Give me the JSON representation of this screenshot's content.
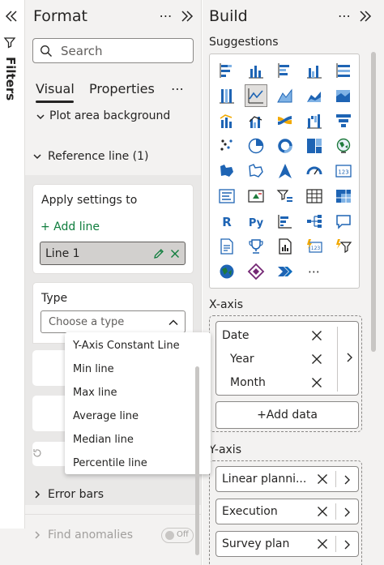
{
  "filters_rail": {
    "label": "Filters"
  },
  "format_pane": {
    "title": "Format",
    "search": {
      "placeholder": "Search",
      "value": ""
    },
    "tabs": [
      {
        "label": "Visual",
        "selected": true
      },
      {
        "label": "Properties",
        "selected": false
      }
    ],
    "plot_area_section": "Plot area background",
    "reference_line": {
      "header": "Reference line (1)",
      "apply_settings_label": "Apply settings to",
      "add_line_label": "+ Add line",
      "selected_line": "Line 1",
      "type_label": "Type",
      "type_placeholder": "Choose a type",
      "type_options": [
        "Y-Axis Constant Line",
        "Min line",
        "Max line",
        "Average line",
        "Median line",
        "Percentile line"
      ]
    },
    "error_bars": "Error bars",
    "find_anomalies": {
      "label": "Find anomalies",
      "toggle": "Off"
    }
  },
  "build_pane": {
    "title": "Build",
    "suggestions_label": "Suggestions",
    "xaxis": {
      "label": "X-axis",
      "fields": [
        "Date",
        "Year",
        "Month"
      ],
      "add_data_label": "+Add data"
    },
    "yaxis": {
      "label": "Y-axis",
      "fields": [
        "Linear planni...",
        "Execution",
        "Survey plan"
      ]
    }
  },
  "colors": {
    "pane_bg": "#f3f2f1",
    "accent_green": "#0f7d3d",
    "text": "#252423",
    "muted": "#605e5c",
    "viz_blue": "#1e64b4",
    "viz_orange": "#f2a900"
  }
}
